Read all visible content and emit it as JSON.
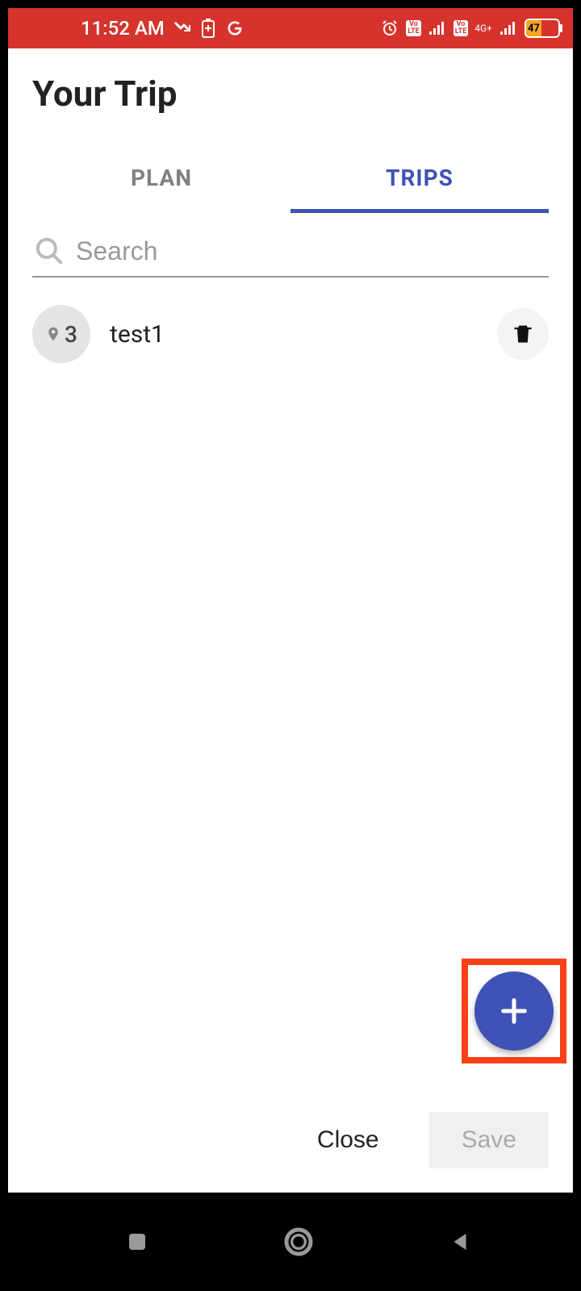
{
  "status": {
    "time": "11:52 AM",
    "battery_percent": "47",
    "network_label": "4G+"
  },
  "header": {
    "title": "Your Trip"
  },
  "tabs": {
    "plan": "PLAN",
    "trips": "TRIPS",
    "active": "trips"
  },
  "search": {
    "placeholder": "Search",
    "value": ""
  },
  "trips": [
    {
      "count": "3",
      "name": "test1"
    }
  ],
  "footer": {
    "close": "Close",
    "save": "Save"
  },
  "icons": {
    "plus": "+"
  }
}
